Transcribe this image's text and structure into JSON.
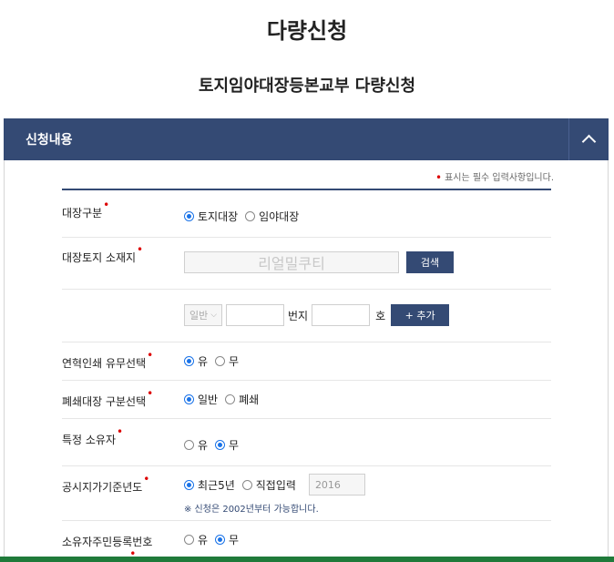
{
  "page_title": "다량신청",
  "subtitle": "토지임야대장등본교부 다량신청",
  "panel": {
    "title": "신청내용"
  },
  "required_note": "표시는 필수 입력사항입니다.",
  "required_mark": "•",
  "form": {
    "ledger_type": {
      "label": "대장구분",
      "options": [
        "토지대장",
        "임야대장"
      ],
      "selected": "토지대장"
    },
    "location": {
      "label": "대장토지 소재지",
      "placeholder": "리얼밀쿠티",
      "search_label": "검색"
    },
    "lot": {
      "type_value": "일반",
      "number_label": "번지",
      "ho_label": "호",
      "add_label": "+ 추가"
    },
    "history_print": {
      "label": "연혁인쇄 유무선택",
      "options": [
        "유",
        "무"
      ],
      "selected": "유"
    },
    "closed_ledger": {
      "label": "폐쇄대장 구분선택",
      "options": [
        "일반",
        "폐쇄"
      ],
      "selected": "일반"
    },
    "specific_owner": {
      "label": "특정 소유자",
      "options": [
        "유",
        "무"
      ],
      "selected": "무"
    },
    "land_price_year": {
      "label": "공시지가기준년도",
      "options": [
        "최근5년",
        "직접입력"
      ],
      "selected": "최근5년",
      "year_value": "2016",
      "hint": "※ 신청은 2002년부터 가능합니다."
    },
    "owner_rrn": {
      "label": "소유자주민등록번호",
      "options": [
        "유",
        "무"
      ],
      "selected": "무"
    }
  }
}
